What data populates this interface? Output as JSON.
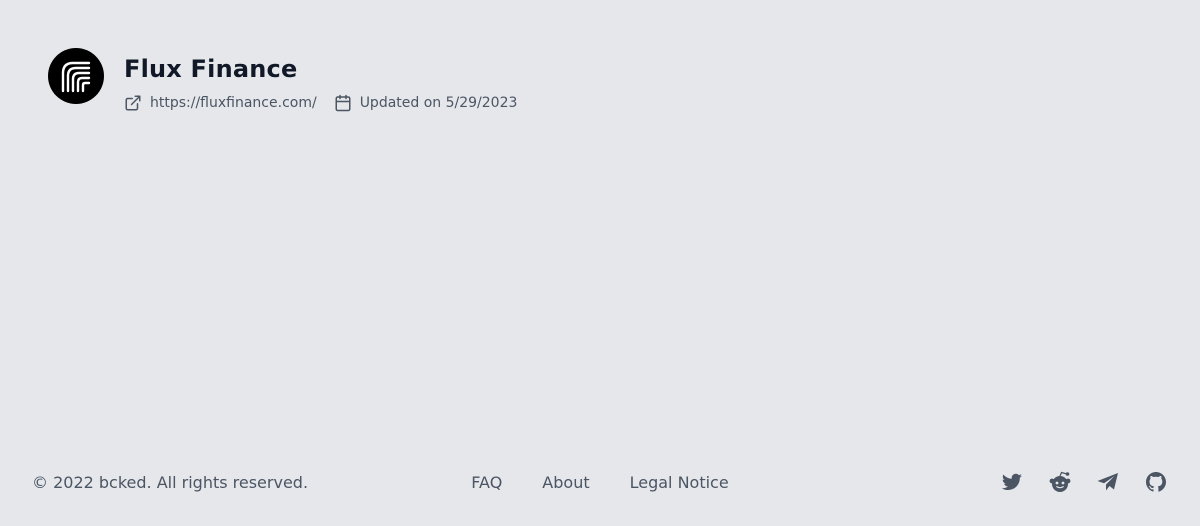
{
  "project": {
    "name": "Flux Finance",
    "url": "https://fluxfinance.com/",
    "updated": "Updated on 5/29/2023",
    "logo_icon": "flux-logo-icon"
  },
  "footer": {
    "copyright": "© 2022 bcked. All rights reserved.",
    "links": [
      "FAQ",
      "About",
      "Legal Notice"
    ],
    "social_icons": [
      "twitter-icon",
      "reddit-icon",
      "telegram-icon",
      "github-icon"
    ]
  },
  "colors": {
    "background": "#e5e7eb",
    "text_primary": "#111827",
    "text_secondary": "#4b5563",
    "logo_bg": "#000000"
  }
}
